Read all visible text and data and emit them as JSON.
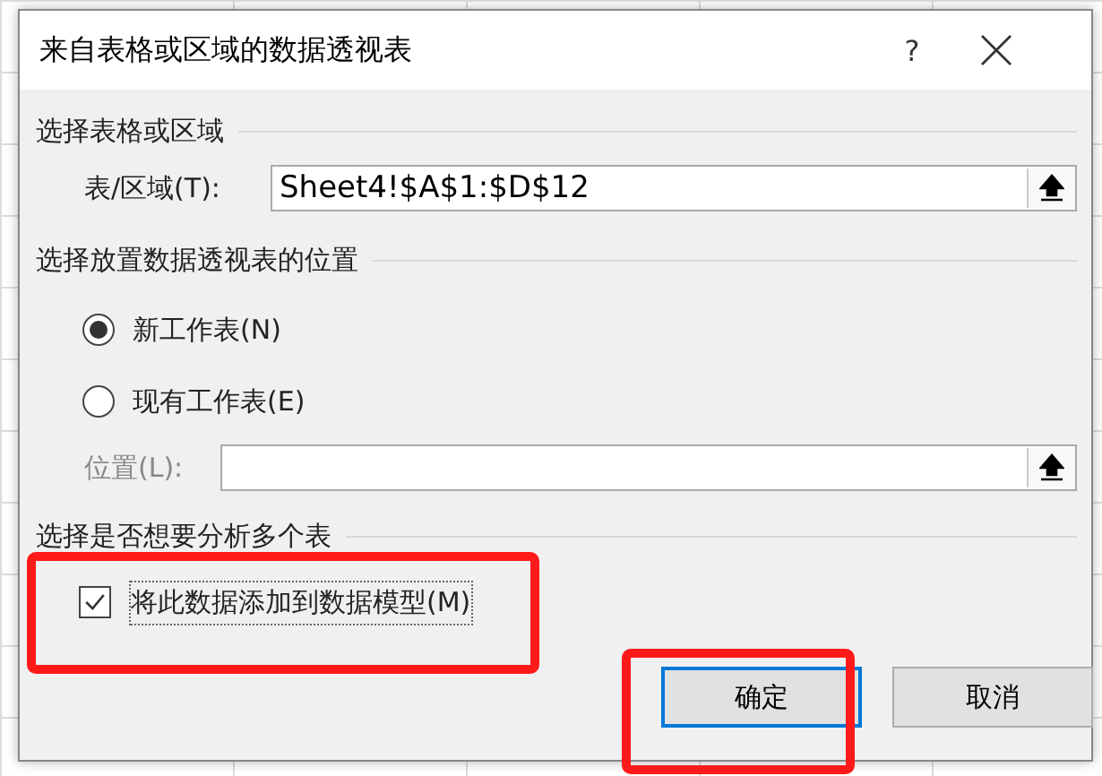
{
  "window": {
    "title": "来自表格或区域的数据透视表",
    "help": "?"
  },
  "source": {
    "heading": "选择表格或区域",
    "label": "表/区域(T):",
    "value": "Sheet4!$A$1:$D$12"
  },
  "placement": {
    "heading": "选择放置数据透视表的位置",
    "options": [
      {
        "label": "新工作表(N)",
        "selected": true
      },
      {
        "label": "现有工作表(E)",
        "selected": false
      }
    ],
    "location": {
      "label": "位置(L):",
      "disabled": true
    }
  },
  "analysis": {
    "heading": "选择是否想要分析多个表",
    "checkbox": {
      "label": "将此数据添加到数据模型(M)",
      "checked": true
    }
  },
  "buttons": [
    {
      "label": "确定",
      "default": true
    },
    {
      "label": "取消",
      "default": false
    }
  ],
  "highlights": [
    {
      "kind": "frame"
    },
    {
      "kind": "frame"
    }
  ]
}
